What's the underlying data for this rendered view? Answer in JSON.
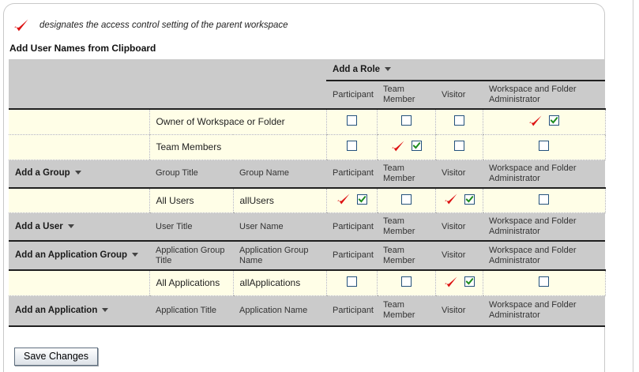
{
  "page": {
    "legend_text": "designates the access control setting of the parent workspace",
    "heading": "Add User Names from Clipboard",
    "save_button_label": "Save Changes"
  },
  "colors": {
    "parent_check": "#dd1111",
    "checkbox_check": "#1e8c1e",
    "header_gray": "#cbcbcb",
    "row_cream": "#fffee7"
  },
  "columns": {
    "participant": "Participant",
    "team_member": "Team Member",
    "visitor": "Visitor",
    "admin": "Workspace and Folder Administrator"
  },
  "table": {
    "add_role_label": "Add a Role",
    "role_rows": [
      {
        "name": "Owner of Workspace or Folder",
        "cells": [
          {
            "parent": false,
            "checked": false
          },
          {
            "parent": false,
            "checked": false
          },
          {
            "parent": false,
            "checked": false
          },
          {
            "parent": true,
            "checked": true
          }
        ]
      },
      {
        "name": "Team Members",
        "cells": [
          {
            "parent": false,
            "checked": false
          },
          {
            "parent": true,
            "checked": true
          },
          {
            "parent": false,
            "checked": false
          },
          {
            "parent": false,
            "checked": false
          }
        ]
      }
    ],
    "sections": [
      {
        "label": "Add a Group",
        "title_col": "Group Title",
        "name_col": "Group Name",
        "rows": [
          {
            "title": "All Users",
            "name": "allUsers",
            "cells": [
              {
                "parent": true,
                "checked": true
              },
              {
                "parent": false,
                "checked": false
              },
              {
                "parent": true,
                "checked": true
              },
              {
                "parent": false,
                "checked": false
              }
            ]
          }
        ]
      },
      {
        "label": "Add a User",
        "title_col": "User Title",
        "name_col": "User Name",
        "rows": []
      },
      {
        "label": "Add an Application Group",
        "title_col": "Application Group Title",
        "name_col": "Application Group Name",
        "rows": [
          {
            "title": "All Applications",
            "name": "allApplications",
            "cells": [
              {
                "parent": false,
                "checked": false
              },
              {
                "parent": false,
                "checked": false
              },
              {
                "parent": true,
                "checked": true
              },
              {
                "parent": false,
                "checked": false
              }
            ]
          }
        ]
      },
      {
        "label": "Add an Application",
        "title_col": "Application Title",
        "name_col": "Application Name",
        "rows": []
      }
    ]
  }
}
